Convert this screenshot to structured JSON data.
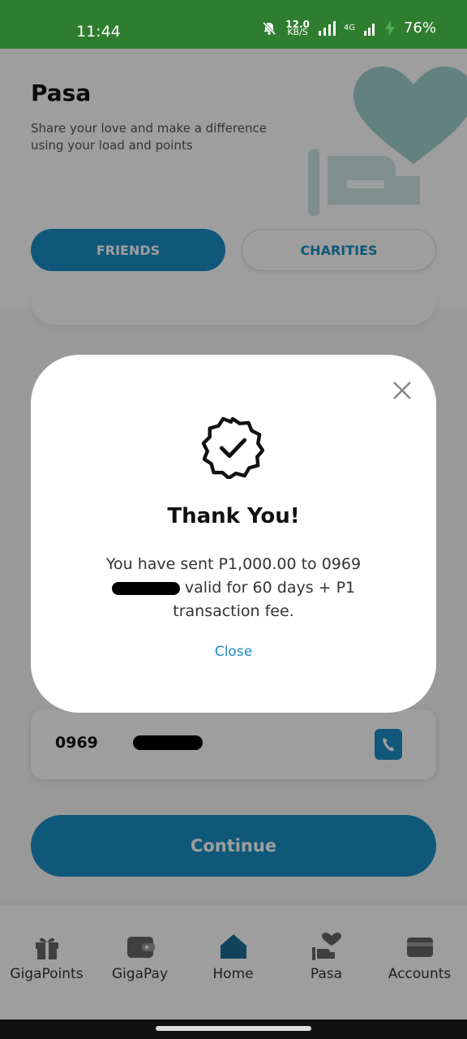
{
  "status_bar": {
    "time": "11:44",
    "net_speed_value": "12.0",
    "net_speed_unit": "KB/S",
    "network_type": "4G",
    "battery": "76%"
  },
  "header": {
    "title": "Pasa",
    "subtitle": "Share your love and make a difference using your load and points"
  },
  "tabs": [
    {
      "label": "FRIENDS",
      "active": true
    },
    {
      "label": "CHARITIES",
      "active": false
    }
  ],
  "number_field": {
    "prefix": "0969"
  },
  "continue_label": "Continue",
  "bottom_nav": [
    {
      "label": "GigaPoints",
      "icon": "gift-icon"
    },
    {
      "label": "GigaPay",
      "icon": "wallet-icon"
    },
    {
      "label": "Home",
      "icon": "home-icon"
    },
    {
      "label": "Pasa",
      "icon": "heart-hand-icon"
    },
    {
      "label": "Accounts",
      "icon": "card-icon"
    }
  ],
  "modal": {
    "title": "Thank You!",
    "message_part1": "You have sent P1,000.00 to 0969",
    "message_part2": "valid for 60 days + P1 transaction fee.",
    "close_label": "Close"
  },
  "colors": {
    "status_bar": "#2f7d2f",
    "accent": "#1b8fc4",
    "hero_teal": "#9fd1cd"
  }
}
